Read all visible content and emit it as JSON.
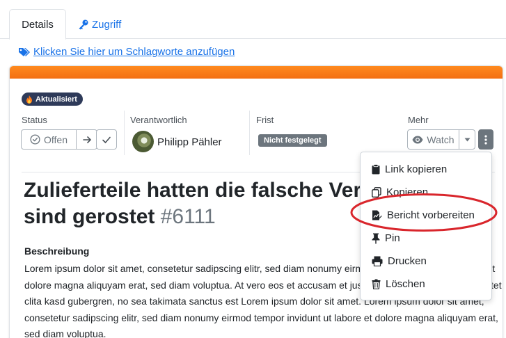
{
  "tabs": {
    "details": "Details",
    "zugriff": "Zugriff"
  },
  "tag_link": "Klicken Sie hier um Schlagworte anzufügen",
  "updated_badge": "Aktualisiert",
  "status": {
    "label": "Status",
    "value": "Offen"
  },
  "assignee": {
    "label": "Verantwortlich",
    "name": "Philipp Pähler"
  },
  "deadline": {
    "label": "Frist",
    "value": "Nicht festgelegt"
  },
  "more": {
    "label": "Mehr",
    "watch": "Watch"
  },
  "issue": {
    "title": "Zulieferteile hatten die falsche Verpackung und sind gerostet",
    "number": "#6111"
  },
  "description": {
    "heading": "Beschreibung",
    "text": "Lorem ipsum dolor sit amet, consetetur sadipscing elitr, sed diam nonumy eirmod tempor invidunt ut labore et dolore magna aliquyam erat, sed diam voluptua. At vero eos et accusam et justo duo dolores et ea rebum. Stet clita kasd gubergren, no sea takimata sanctus est Lorem ipsum dolor sit amet. Lorem ipsum dolor sit amet, consetetur sadipscing elitr, sed diam nonumy eirmod tempor invidunt ut labore et dolore magna aliquyam erat, sed diam voluptua."
  },
  "menu": {
    "items": [
      {
        "label": "Link kopieren",
        "icon": "clipboard-icon"
      },
      {
        "label": "Kopieren",
        "icon": "copy-icon"
      },
      {
        "label": "Bericht vorbereiten",
        "icon": "report-icon"
      },
      {
        "label": "Pin",
        "icon": "pin-icon"
      },
      {
        "label": "Drucken",
        "icon": "print-icon"
      },
      {
        "label": "Löschen",
        "icon": "trash-icon"
      }
    ]
  },
  "colors": {
    "accent": "#f36f12",
    "link": "#1a73e8",
    "highlight": "#d9262c"
  }
}
